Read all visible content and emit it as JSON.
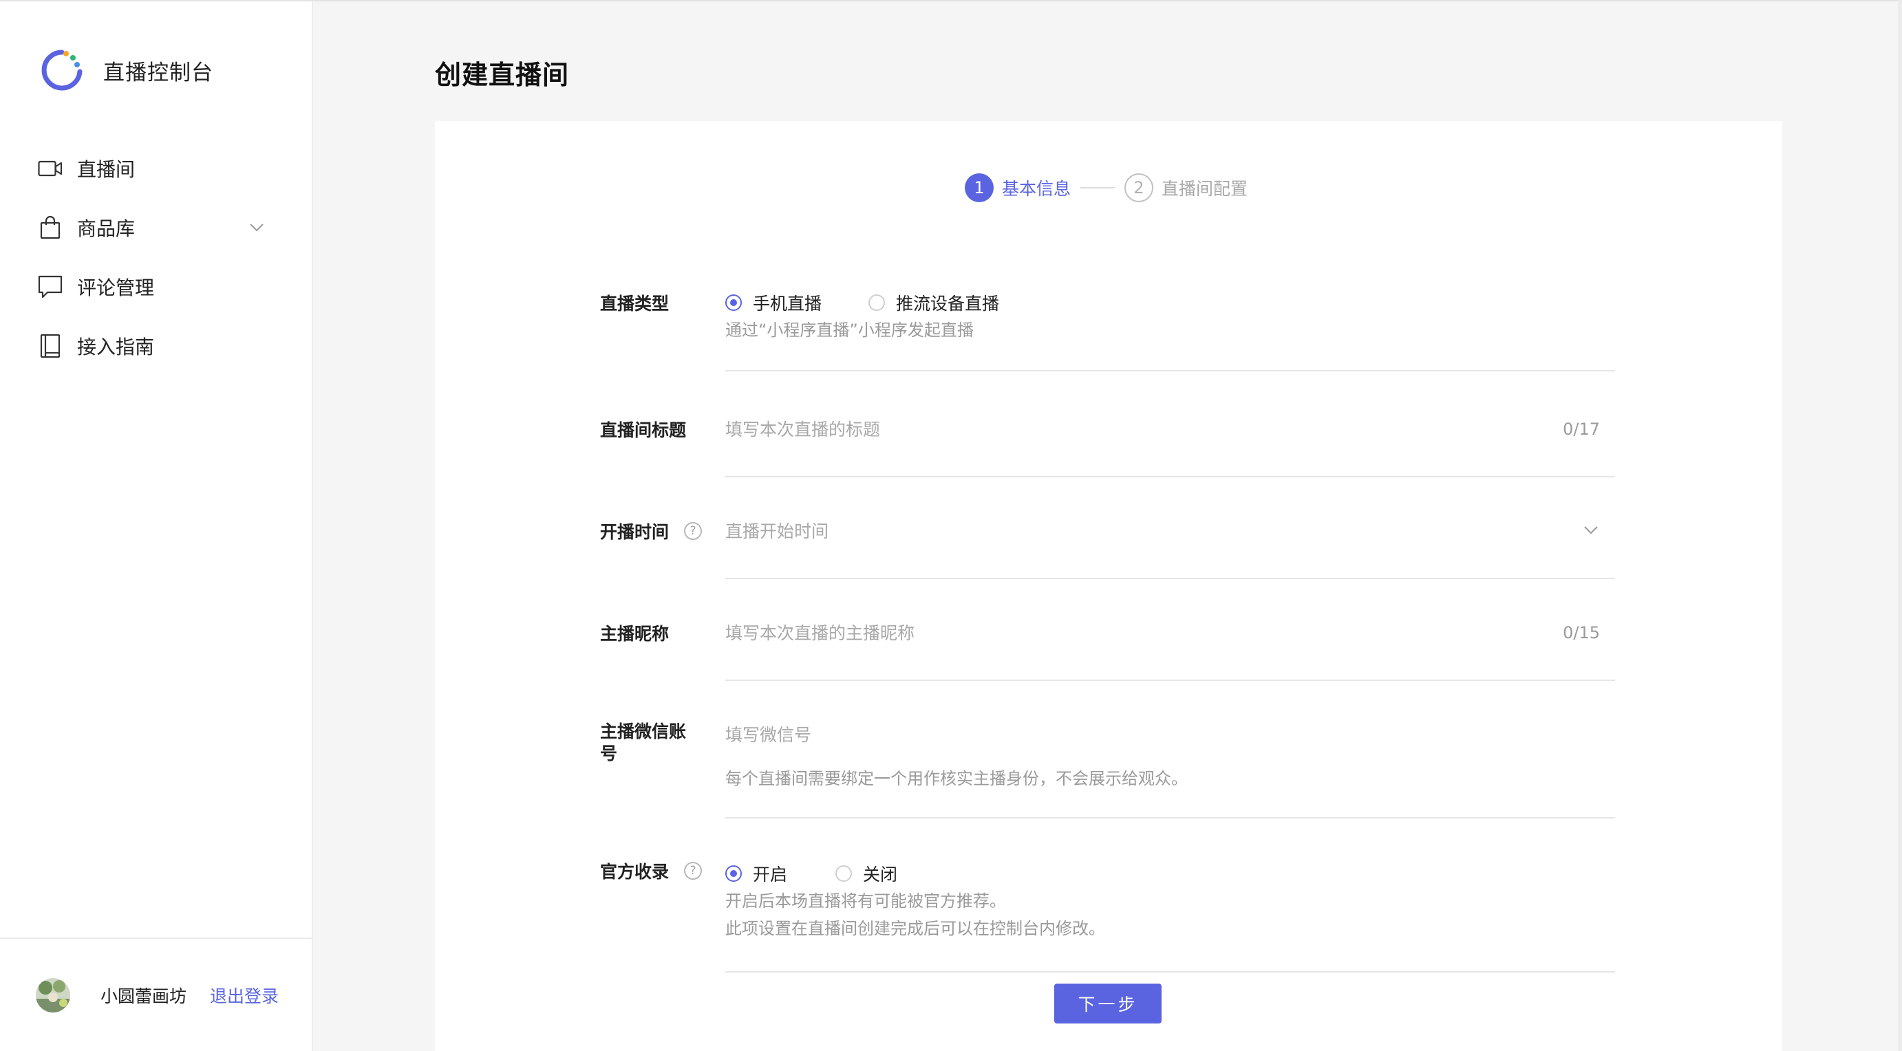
{
  "app": {
    "name": "直播控制台"
  },
  "sidebar": {
    "items": [
      {
        "label": "直播间",
        "icon": "video-camera-icon"
      },
      {
        "label": "商品库",
        "icon": "shopping-bag-icon",
        "has_dropdown": true
      },
      {
        "label": "评论管理",
        "icon": "comment-icon"
      },
      {
        "label": "接入指南",
        "icon": "book-icon"
      }
    ],
    "user": {
      "name": "小圆蕾画坊",
      "logout_label": "退出登录"
    }
  },
  "page": {
    "title": "创建直播间"
  },
  "steps": [
    {
      "number": "1",
      "label": "基本信息",
      "active": true
    },
    {
      "number": "2",
      "label": "直播间配置",
      "active": false
    }
  ],
  "form": {
    "live_type": {
      "label": "直播类型",
      "options": [
        {
          "label": "手机直播",
          "checked": true
        },
        {
          "label": "推流设备直播",
          "checked": false
        }
      ],
      "hint": "通过“小程序直播”小程序发起直播"
    },
    "title": {
      "label": "直播间标题",
      "placeholder": "填写本次直播的标题",
      "counter": "0/17"
    },
    "start_time": {
      "label": "开播时间",
      "placeholder": "直播开始时间"
    },
    "anchor_nickname": {
      "label": "主播昵称",
      "placeholder": "填写本次直播的主播昵称",
      "counter": "0/15"
    },
    "anchor_wechat": {
      "label_line1": "主播微信账",
      "label_line2": "号",
      "placeholder": "填写微信号",
      "hint": "每个直播间需要绑定一个用作核实主播身份，不会展示给观众。"
    },
    "official_collection": {
      "label": "官方收录",
      "options": [
        {
          "label": "开启",
          "checked": true
        },
        {
          "label": "关闭",
          "checked": false
        }
      ],
      "hint_line1": "开启后本场直播将有可能被官方推荐。",
      "hint_line2": "此项设置在直播间创建完成后可以在控制台内修改。"
    },
    "next_label": "下一步"
  },
  "colors": {
    "accent": "#5a64e0",
    "text": "#222222",
    "muted": "#9a9a9a",
    "divider": "#e6e6e6",
    "page_bg": "#f5f5f5"
  }
}
